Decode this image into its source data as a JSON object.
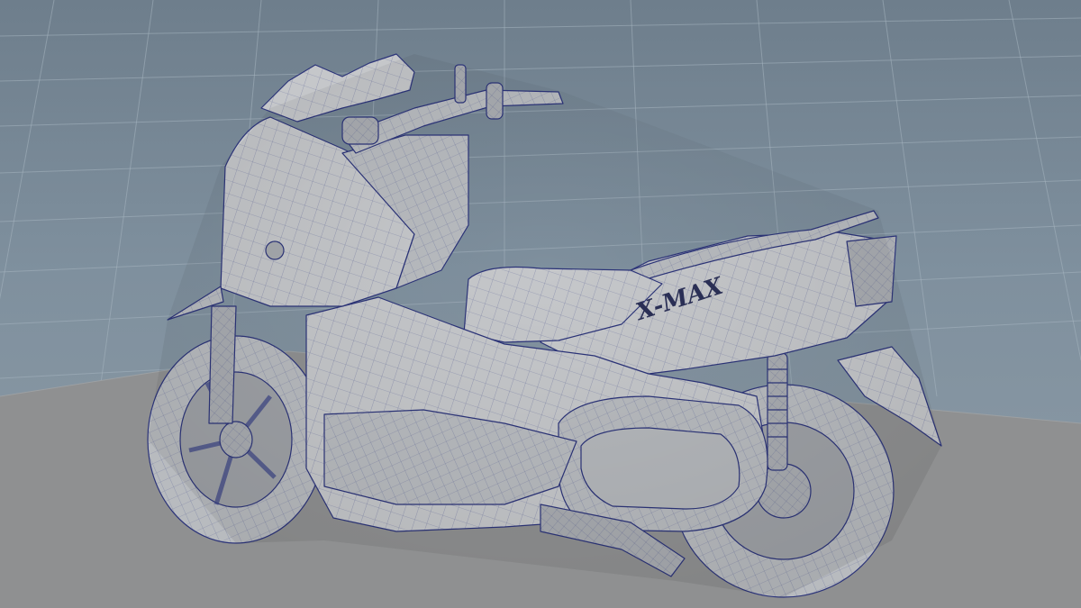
{
  "viewport": {
    "background_top": "#6e7e8c",
    "background_bottom": "#8d9ba6",
    "grid_color": "#9aabb8",
    "ground_color": "#8e8f90",
    "model_fill": "#c7c9cc",
    "wire_color": "#2c3479"
  },
  "model": {
    "name": "scooter-wireframe-model",
    "badge_text": "X-MAX",
    "badge_icon": "brand-logo"
  }
}
